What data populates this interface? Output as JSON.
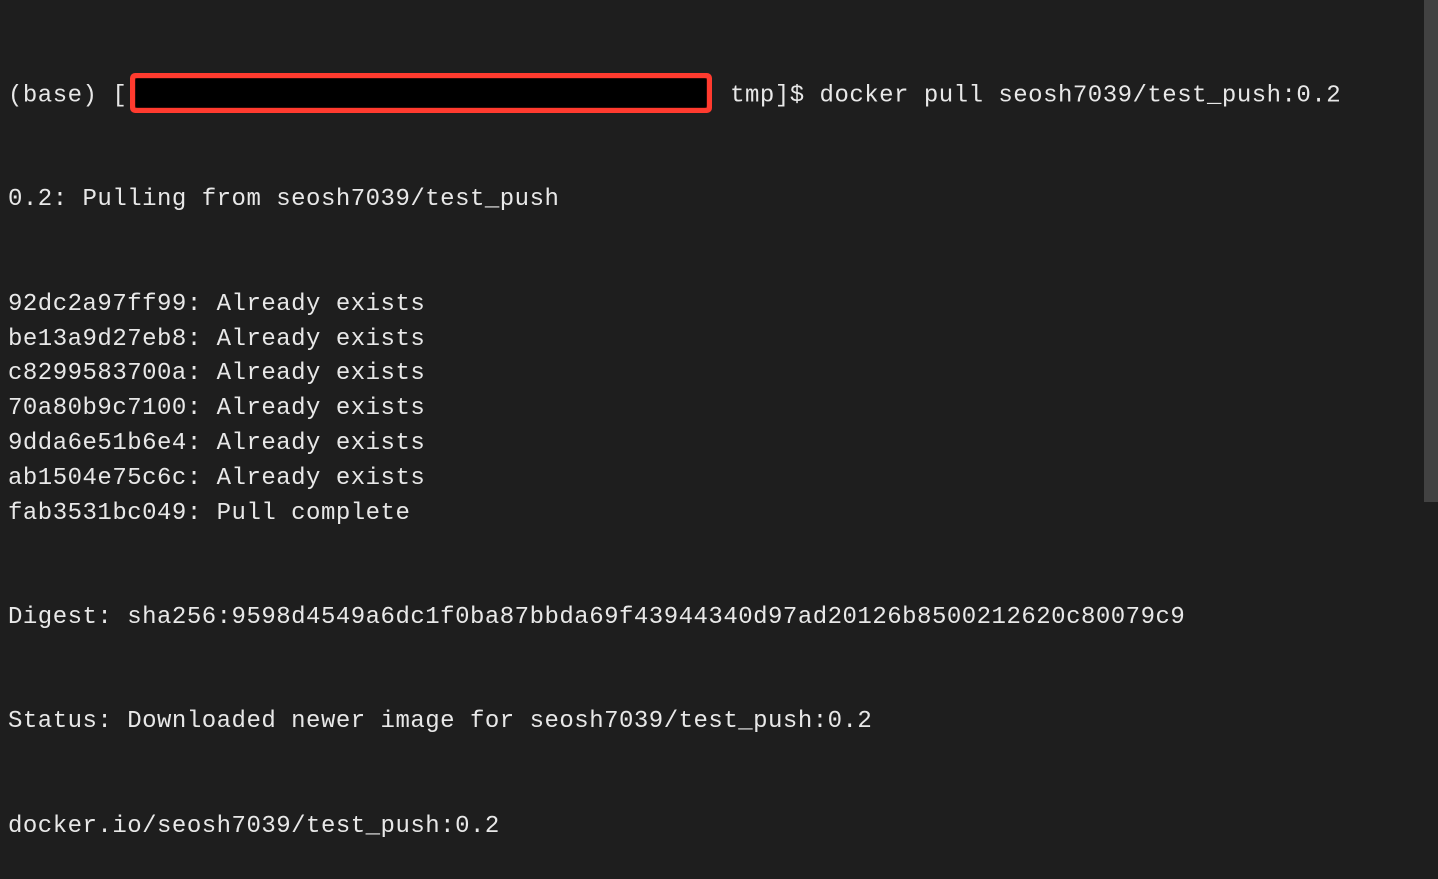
{
  "prompt": {
    "prefix": "(base) [",
    "suffix": " tmp]$ ",
    "command": "docker pull seosh7039/test_push:0.2"
  },
  "output": {
    "pulling": "0.2: Pulling from seosh7039/test_push",
    "layers": [
      {
        "hash": "92dc2a97ff99",
        "status": "Already exists"
      },
      {
        "hash": "be13a9d27eb8",
        "status": "Already exists"
      },
      {
        "hash": "c8299583700a",
        "status": "Already exists"
      },
      {
        "hash": "70a80b9c7100",
        "status": "Already exists"
      },
      {
        "hash": "9dda6e51b6e4",
        "status": "Already exists"
      },
      {
        "hash": "ab1504e75c6c",
        "status": "Already exists"
      },
      {
        "hash": "fab3531bc049",
        "status": "Pull complete"
      }
    ],
    "digest": "Digest: sha256:9598d4549a6dc1f0ba87bbda69f43944340d97ad20126b8500212620c80079c9",
    "status": "Status: Downloaded newer image for seosh7039/test_push:0.2",
    "resolved": "docker.io/seosh7039/test_push:0.2"
  }
}
